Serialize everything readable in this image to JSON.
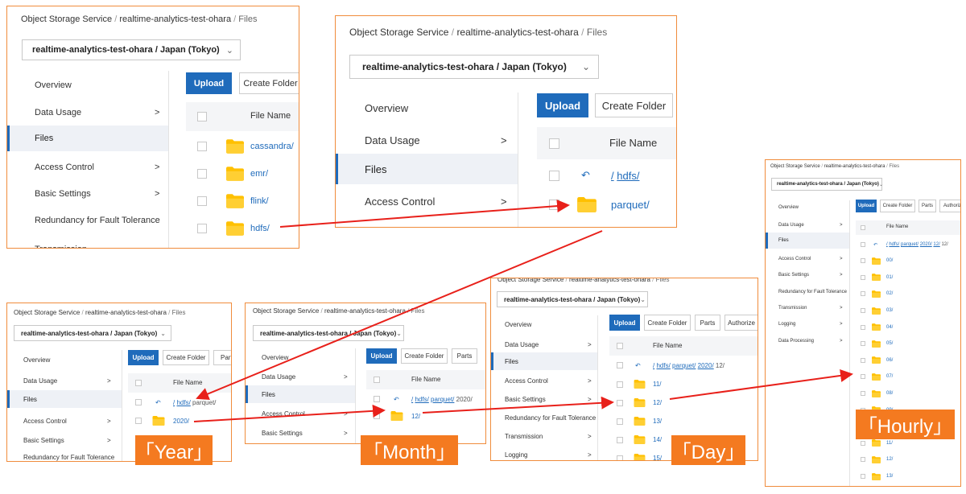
{
  "common": {
    "service": "Object Storage Service",
    "bucket": "realtime-analytics-test-ohara",
    "files": "Files",
    "region": "realtime-analytics-test-ohara / Japan (Tokyo)",
    "sep": "/",
    "chevron": "⌄",
    "arrow": ">",
    "upload": "Upload",
    "create_folder": "Create Folder",
    "parts": "Parts",
    "authorize": "Authorize",
    "file_name": "File Name",
    "back_icon": "↶"
  },
  "nav": {
    "overview": "Overview",
    "data_usage": "Data Usage",
    "files": "Files",
    "access_control": "Access Control",
    "basic_settings": "Basic Settings",
    "redundancy": "Redundancy for Fault Tolerance",
    "transmission": "Transmission",
    "logging": "Logging",
    "data_processing": "Data Processing"
  },
  "panel1": {
    "folders": [
      "cassandra/",
      "emr/",
      "flink/",
      "hdfs/"
    ]
  },
  "panel2": {
    "path": [
      "/",
      "hdfs/"
    ],
    "folder": "parquet/"
  },
  "panel3": {
    "path": [
      "/",
      "hdfs/",
      "parquet/"
    ],
    "folder": "2020/",
    "tag": "「Year」"
  },
  "panel4": {
    "path": [
      "/",
      "hdfs/",
      "parquet/",
      "2020/"
    ],
    "folder": "12/",
    "tag": "「Month」"
  },
  "panel5": {
    "path": [
      "/",
      "hdfs/",
      "parquet/",
      "2020/",
      "12/"
    ],
    "folders": [
      "11/",
      "12/",
      "13/",
      "14/",
      "15/"
    ],
    "tag": "「Day」"
  },
  "panel6": {
    "path": [
      "/",
      "hdfs/",
      "parquet/",
      "2020/",
      "12/",
      "12/"
    ],
    "folders": [
      "00/",
      "01/",
      "02/",
      "03/",
      "04/",
      "05/",
      "06/",
      "07/",
      "08/",
      "09/",
      "10/",
      "11/",
      "12/",
      "13/"
    ],
    "tag": "「Hourly」"
  },
  "colors": {
    "accent_orange": "#f47a20",
    "panel_border": "#f08c3c",
    "primary_blue": "#1f6bbb",
    "folder_yellow": "#ffc000",
    "arrow_red": "#e8201a"
  }
}
